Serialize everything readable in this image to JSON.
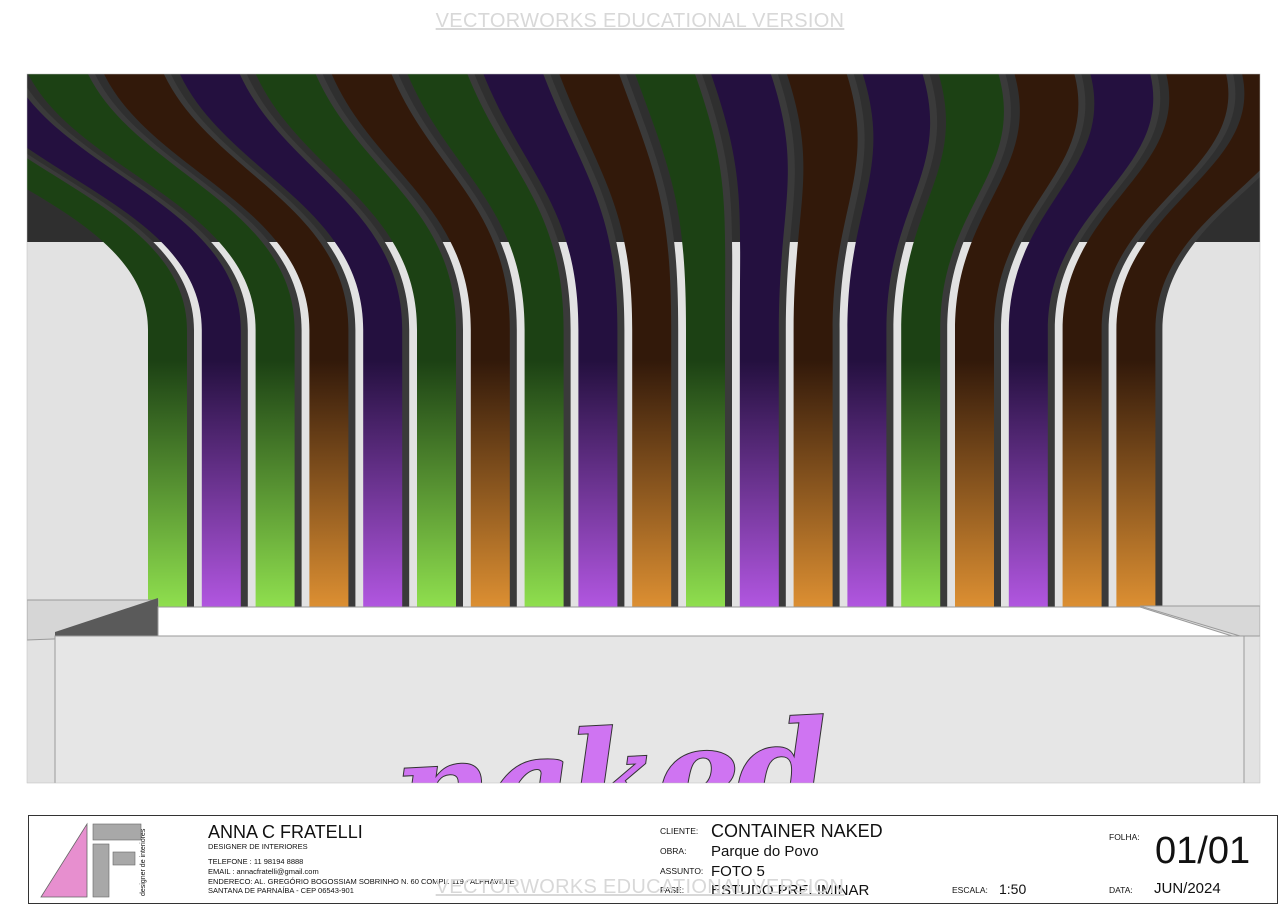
{
  "watermark": "VECTORWORKS EDUCATIONAL VERSION",
  "render": {
    "logo_text": "naked",
    "colors": {
      "green": "#8fdf4e",
      "purple": "#b156e0",
      "orange": "#dc8f32",
      "green_dark": "#1c4114",
      "purple_dark": "#24103f",
      "orange_dark": "#32190a",
      "ceiling": "#2f2f2f",
      "wall": "#e2e2e2",
      "counter": "#e6e6e6",
      "logo": "#cf74f2"
    },
    "slat_colors": [
      "green",
      "purple",
      "green",
      "orange",
      "purple",
      "green",
      "orange",
      "green",
      "purple",
      "orange",
      "green",
      "purple",
      "orange",
      "purple",
      "green",
      "orange",
      "purple",
      "orange",
      "orange"
    ]
  },
  "title_block": {
    "designer_name": "ANNA C FRATELLI",
    "designer_role": "DESIGNER DE INTERIORES",
    "logo_caption": "designer de interiores",
    "phone": "TELEFONE : 11 98194 8888",
    "email": "EMAIL : annacfratelli@gmail.com",
    "address": "ENDERECO: AL. GREGÓRIO BOGOSSIAM SOBRINHO    N. 60 COMPL. 119 - ALPHAVILLE",
    "city": "SANTANA DE PARNAÍBA  - CEP 06543-901",
    "cliente_label": "CLIENTE:",
    "cliente": "CONTAINER NAKED",
    "obra_label": "OBRA:",
    "obra": "Parque do Povo",
    "assunto_label": "ASSUNTO:",
    "assunto": "FOTO 5",
    "fase_label": "FASE:",
    "fase": "ESTUDO PRELIMINAR",
    "escala_label": "ESCALA:",
    "escala": "1:50",
    "folha_label": "FOLHA:",
    "folha": "01/01",
    "data_label": "DATA:",
    "data": "JUN/2024"
  }
}
